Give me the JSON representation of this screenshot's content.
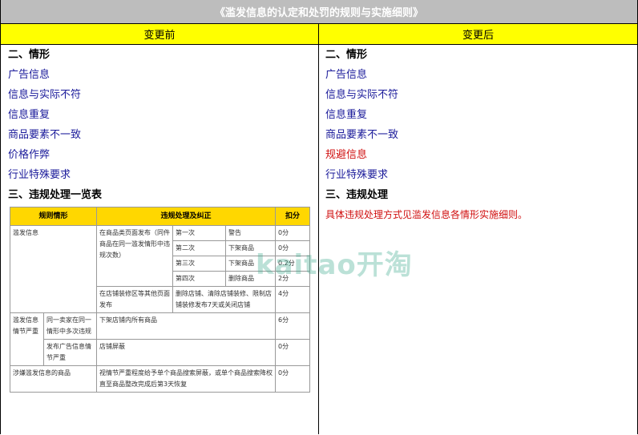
{
  "title": "《滥发信息的认定和处罚的规则与实施细则》",
  "columns": {
    "before": "变更前",
    "after": "变更后"
  },
  "before": {
    "section2": "二、情形",
    "items": [
      "广告信息",
      "信息与实际不符",
      "信息重复",
      "商品要素不一致",
      "价格作弊",
      "行业特殊要求"
    ],
    "section3": "三、违规处理一览表"
  },
  "after": {
    "section2": "二、情形",
    "items": [
      "广告信息",
      "信息与实际不符",
      "信息重复",
      "商品要素不一致",
      "规避信息",
      "行业特殊要求"
    ],
    "section3": "三、违规处理",
    "note": "具体违规处理方式见滥发信息各情形实施细则。"
  },
  "table": {
    "headers": [
      "规则情形",
      "违规处理及纠正",
      "扣分"
    ],
    "r1_case": "滥发信息",
    "r1_desc": "在商品类页面发布（同件商品在同一滥发情形中违规次数）",
    "r1_steps": [
      {
        "n": "第一次",
        "action": "警告",
        "score": "0分"
      },
      {
        "n": "第二次",
        "action": "下架商品",
        "score": "0分"
      },
      {
        "n": "第三次",
        "action": "下架商品",
        "score": "0.2分"
      },
      {
        "n": "第四次",
        "action": "删除商品",
        "score": "2分"
      }
    ],
    "r1_other_desc": "在店铺装修区等其他页面发布",
    "r1_other_action": "删除店铺、清除店铺装修、限制店铺装修发布7天或关闭店铺",
    "r1_other_score": "4分",
    "r2_case": "滥发信息情节严重",
    "r2a_desc": "同一卖家在同一情形中多次违规",
    "r2a_action": "下架店铺内所有商品",
    "r2a_score": "6分",
    "r2b_desc": "发布广告信息情节严重",
    "r2b_action": "店铺屏蔽",
    "r2b_score": "0分",
    "r3_case": "涉嫌滥发信息的商品",
    "r3_action": "视情节严重程度给予单个商品搜索屏蔽，或单个商品搜索降权直至商品整改完成后第3天恢复",
    "r3_score": "0分"
  },
  "watermark": "kaitao开淘"
}
